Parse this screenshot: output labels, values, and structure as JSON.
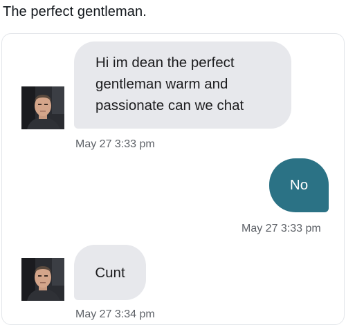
{
  "post": {
    "caption": "The perfect gentleman."
  },
  "conversation": {
    "messages": [
      {
        "direction": "incoming",
        "lines": [
          "Hi im dean the perfect",
          "gentleman warm and",
          "passionate can we chat"
        ],
        "timestamp": "May 27 3:33 pm"
      },
      {
        "direction": "outgoing",
        "text": "No",
        "timestamp": "May 27 3:33 pm"
      },
      {
        "direction": "incoming",
        "text": "Cunt",
        "timestamp": "May 27 3:34 pm"
      }
    ]
  },
  "colors": {
    "incoming_bubble": "#e7e8ec",
    "outgoing_bubble": "#2b7285",
    "timestamp_text": "#5e6268"
  }
}
